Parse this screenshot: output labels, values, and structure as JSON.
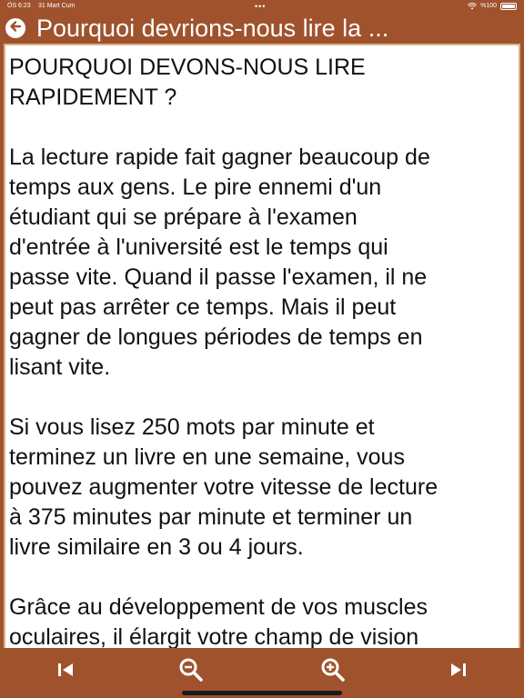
{
  "status_bar": {
    "time": "ÖS 6:23",
    "date": "31 Mart Cum",
    "dots": "•••",
    "battery": "%100"
  },
  "header": {
    "title": "Pourquoi devrions-nous lire la ..."
  },
  "article": {
    "text": "POURQUOI DEVONS-NOUS LIRE\nRAPIDEMENT ?\n\nLa lecture rapide fait gagner beaucoup de\ntemps aux gens. Le pire ennemi d'un\nétudiant qui se prépare à l'examen\nd'entrée à l'université est le temps qui\npasse vite. Quand il passe l'examen, il ne\npeut pas arrêter ce temps. Mais il peut\ngagner de longues périodes de temps en\nlisant vite.\n\nSi vous lisez 250 mots par minute et\nterminez un livre en une semaine, vous\npouvez augmenter votre vitesse de lecture\nà 375 minutes par minute et terminer un\nlivre similaire en 3 ou 4 jours.\n\nGrâce au développement de vos muscles\noculaires, il élargit votre champ de vision"
  },
  "toolbar": {
    "buttons": [
      {
        "icon": "skip-previous-icon"
      },
      {
        "icon": "zoom-out-icon"
      },
      {
        "icon": "zoom-in-icon"
      },
      {
        "icon": "skip-next-icon"
      }
    ]
  },
  "colors": {
    "bar": "#a0522d",
    "panel_border": "#d4b48a",
    "text": "#111111"
  }
}
